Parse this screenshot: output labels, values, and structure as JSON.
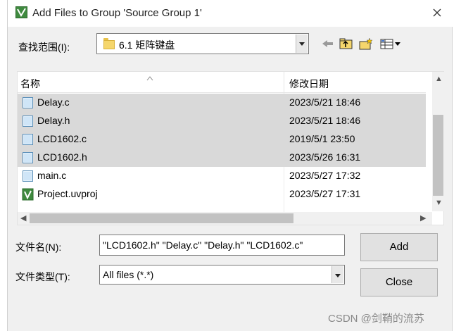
{
  "window": {
    "title": "Add Files to Group 'Source Group 1'"
  },
  "lookin": {
    "label": "查找范围(I):",
    "value": "6.1 矩阵键盘"
  },
  "toolbar_icons": [
    "back-arrow-icon",
    "up-folder-icon",
    "new-folder-icon",
    "view-menu-icon"
  ],
  "list": {
    "columns": {
      "name": "名称",
      "date": "修改日期"
    },
    "files": [
      {
        "name": "Delay.c",
        "date": "2023/5/21 18:46",
        "selected": true,
        "icon": "c-file-icon"
      },
      {
        "name": "Delay.h",
        "date": "2023/5/21 18:46",
        "selected": true,
        "icon": "h-file-icon"
      },
      {
        "name": "LCD1602.c",
        "date": "2019/5/1 23:50",
        "selected": true,
        "icon": "c-file-icon"
      },
      {
        "name": "LCD1602.h",
        "date": "2023/5/26 16:31",
        "selected": true,
        "icon": "h-file-icon"
      },
      {
        "name": "main.c",
        "date": "2023/5/27 17:32",
        "selected": false,
        "icon": "c-file-icon"
      },
      {
        "name": "Project.uvproj",
        "date": "2023/5/27 17:31",
        "selected": false,
        "icon": "uvproj-icon"
      }
    ]
  },
  "filename": {
    "label": "文件名(N):",
    "value": "\"LCD1602.h\" \"Delay.c\" \"Delay.h\" \"LCD1602.c\""
  },
  "filetype": {
    "label": "文件类型(T):",
    "value": "All files (*.*)"
  },
  "buttons": {
    "add": "Add",
    "close": "Close"
  },
  "watermark": "CSDN @剑鞘的流苏",
  "colors": {
    "selection": "#d9d9d9",
    "accent": "#3f8a3f"
  }
}
